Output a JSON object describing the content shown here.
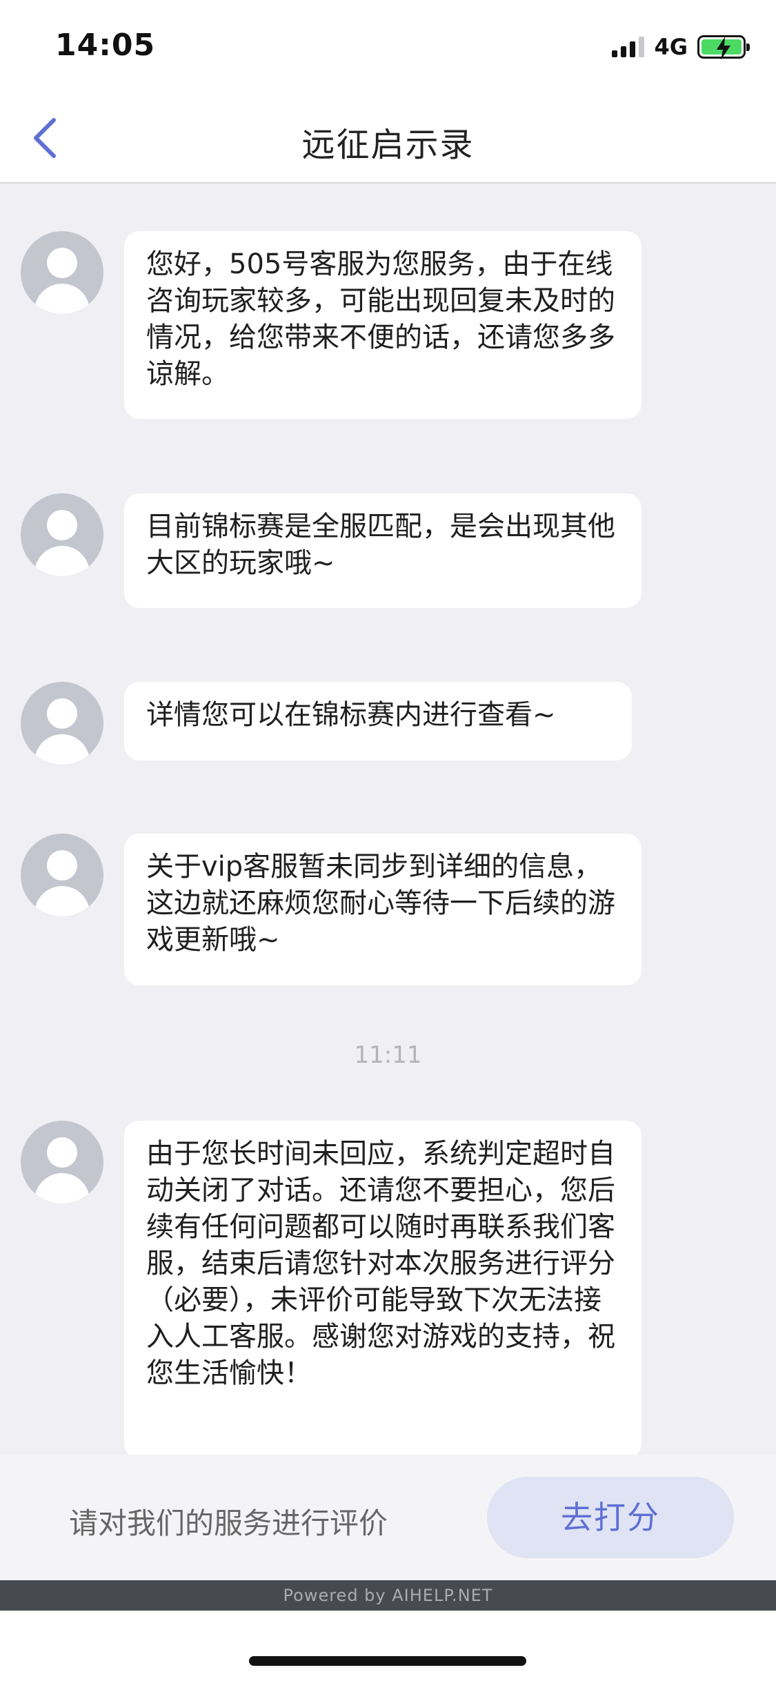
{
  "status_bar": {
    "time": "14:05",
    "network": "4G",
    "battery_color": "#4cd964"
  },
  "nav": {
    "title": "远征启示录"
  },
  "messages": [
    {
      "text": "您好，505号客服为您服务，由于在线咨询玩家较多，可能出现回复未及时的情况，给您带来不便的话，还请您多多谅解。"
    },
    {
      "text": "目前锦标赛是全服匹配，是会出现其他大区的玩家哦~"
    },
    {
      "text": "详情您可以在锦标赛内进行查看~"
    },
    {
      "text": "关于vip客服暂未同步到详细的信息，这边就还麻烦您耐心等待一下后续的游戏更新哦~"
    },
    {
      "text": "由于您长时间未回应，系统判定超时自动关闭了对话。还请您不要担心，您后续有任何问题都可以随时再联系我们客服，结束后请您针对本次服务进行评分（必要），未评价可能导致下次无法接入人工客服。感谢您对游戏的支持，祝您生活愉快！"
    }
  ],
  "timestamp": "11:11",
  "rating": {
    "prompt": "请对我们的服务进行评价",
    "button_label": "去打分",
    "accent_color": "#5f6fd4"
  },
  "footer": {
    "powered_by": "Powered by AIHELP.NET"
  }
}
